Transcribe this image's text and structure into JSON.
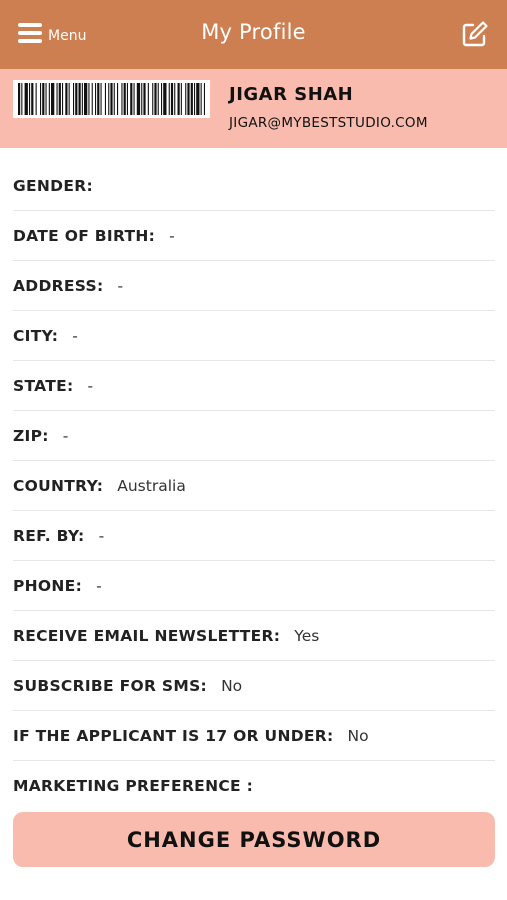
{
  "header": {
    "menu_label": "Menu",
    "title": "My Profile",
    "menu_icon": "hamburger-icon",
    "edit_icon": "edit-icon",
    "color": "#cd7f52"
  },
  "profile": {
    "name": "JIGAR SHAH",
    "email": "JIGAR@MYBESTSTUDIO.COM",
    "band_color": "#f8bbad"
  },
  "fields": [
    {
      "label": "GENDER:",
      "value": ""
    },
    {
      "label": "DATE OF BIRTH:",
      "value": "-"
    },
    {
      "label": "ADDRESS:",
      "value": "-"
    },
    {
      "label": "CITY:",
      "value": "-"
    },
    {
      "label": "STATE:",
      "value": "-"
    },
    {
      "label": "ZIP:",
      "value": "-"
    },
    {
      "label": "COUNTRY:",
      "value": "Australia"
    },
    {
      "label": "REF. BY:",
      "value": "-"
    },
    {
      "label": "PHONE:",
      "value": "-"
    },
    {
      "label": "RECEIVE EMAIL NEWSLETTER:",
      "value": "Yes"
    },
    {
      "label": "SUBSCRIBE FOR SMS:",
      "value": "No"
    },
    {
      "label": "IF THE APPLICANT IS 17 OR UNDER:",
      "value": "No"
    },
    {
      "label": "MARKETING PREFERENCE :",
      "value": ""
    }
  ],
  "change_password_label": "CHANGE PASSWORD"
}
